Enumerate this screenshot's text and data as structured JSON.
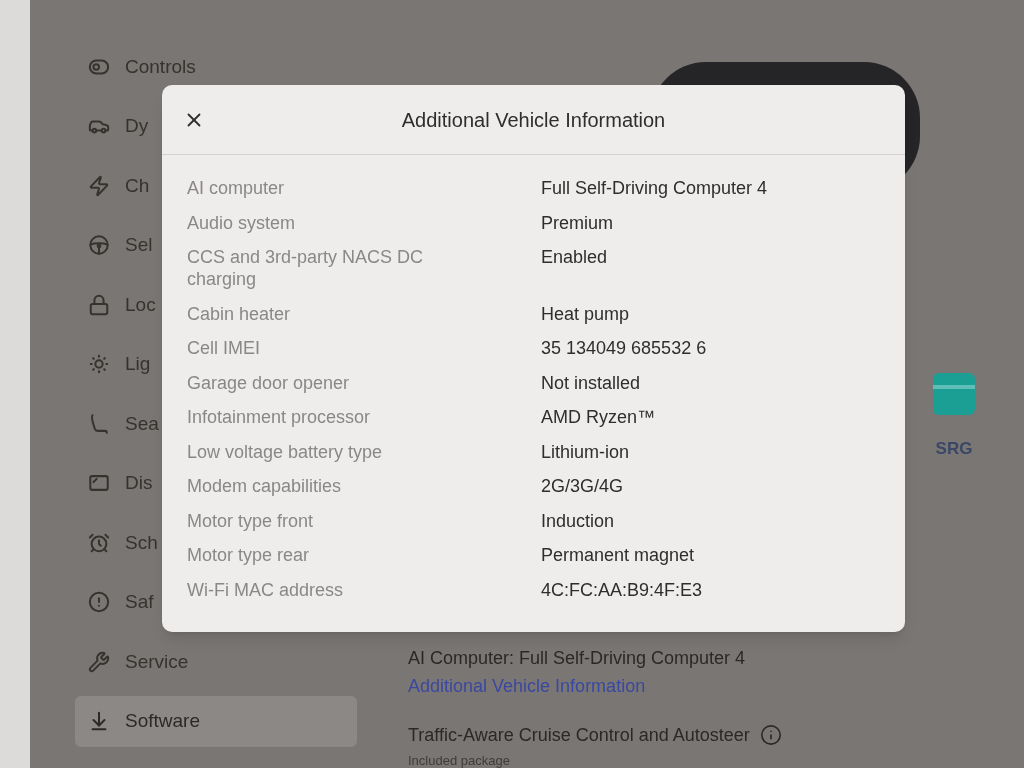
{
  "sidebar": {
    "items": [
      {
        "label": "Controls",
        "selected": false
      },
      {
        "label": "Dy",
        "selected": false
      },
      {
        "label": "Ch",
        "selected": false
      },
      {
        "label": "Sel",
        "selected": false
      },
      {
        "label": "Loc",
        "selected": false
      },
      {
        "label": "Lig",
        "selected": false
      },
      {
        "label": "Sea",
        "selected": false
      },
      {
        "label": "Dis",
        "selected": false
      },
      {
        "label": "Sch",
        "selected": false
      },
      {
        "label": "Saf",
        "selected": false
      },
      {
        "label": "Service",
        "selected": false
      },
      {
        "label": "Software",
        "selected": true
      }
    ]
  },
  "dialog": {
    "title": "Additional Vehicle Information",
    "rows": [
      {
        "label": "AI computer",
        "value": "Full Self-Driving Computer 4"
      },
      {
        "label": "Audio system",
        "value": "Premium"
      },
      {
        "label": "CCS and 3rd-party NACS DC charging",
        "value": "Enabled"
      },
      {
        "label": "Cabin heater",
        "value": "Heat pump"
      },
      {
        "label": "Cell IMEI",
        "value": "35 134049 685532 6"
      },
      {
        "label": "Garage door opener",
        "value": "Not installed"
      },
      {
        "label": "Infotainment processor",
        "value": "AMD Ryzen™"
      },
      {
        "label": "Low voltage battery type",
        "value": "Lithium-ion"
      },
      {
        "label": "Modem capabilities",
        "value": "2G/3G/4G"
      },
      {
        "label": "Motor type front",
        "value": "Induction"
      },
      {
        "label": "Motor type rear",
        "value": "Permanent magnet"
      },
      {
        "label": "Wi-Fi MAC address",
        "value": "4C:FC:AA:B9:4F:E3"
      }
    ]
  },
  "main": {
    "shortcut": {
      "label": "SRG"
    },
    "ai_computer": "AI Computer: Full Self-Driving Computer 4",
    "info_link": "Additional Vehicle Information",
    "feature": {
      "title": "Traffic-Aware Cruise Control and Autosteer",
      "subtitle": "Included package"
    }
  }
}
